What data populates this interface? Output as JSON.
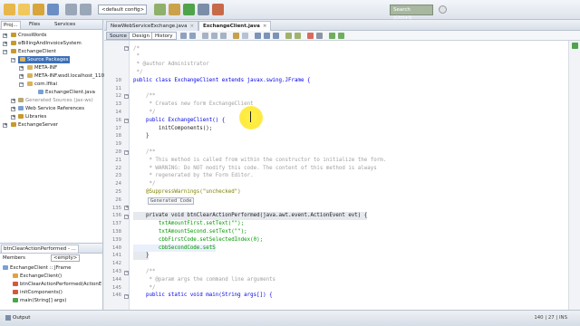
{
  "toolbar": {
    "config": "<default config>",
    "search_label": "Search (Ctrl+I)"
  },
  "projects": {
    "tabs": [
      "Proj...",
      "Files",
      "Services"
    ],
    "tree": [
      {
        "label": "CrossWords",
        "icon_color": "#c79a2e"
      },
      {
        "label": "eBillingAndInvoiceSystem",
        "icon_color": "#c79a2e"
      },
      {
        "label": "ExchangeClient",
        "icon_color": "#c79a2e"
      },
      {
        "label": "Source Packages",
        "icon_color": "#d9b35a"
      },
      {
        "label": "META-INF",
        "icon_color": "#d9b35a"
      },
      {
        "label": "META-INF.wsdl.localhost_110",
        "icon_color": "#d9b35a"
      },
      {
        "label": "com.lfitai",
        "icon_color": "#d9b35a"
      },
      {
        "label": "ExchangeClient.java",
        "icon_color": "#7aa0d4"
      },
      {
        "label": "Generated Sources (jax-ws)",
        "icon_color": "#b9a770"
      },
      {
        "label": "Web Service References",
        "icon_color": "#7aa0d4"
      },
      {
        "label": "Libraries",
        "icon_color": "#c79a2e"
      },
      {
        "label": "ExchangeServer",
        "icon_color": "#c79a2e"
      }
    ]
  },
  "navigator": {
    "title": "btnClearActionPerformed - ...",
    "members_label": "Members",
    "filter": "<empty>",
    "root": "ExchangeClient :: JFrame",
    "items": [
      "ExchangeClient()",
      "btnClearActionPerformed(ActionE",
      "initComponents()",
      "main(String[] args)"
    ]
  },
  "editor": {
    "tabs": [
      "NewWebServiceExchange.java",
      "ExchangeClient.java"
    ],
    "source_label": "Source",
    "design_label": "Design",
    "history_label": "History"
  },
  "code": {
    "lines": [
      {
        "num": "",
        "text": "/*"
      },
      {
        "num": "",
        "text": " *"
      },
      {
        "num": "",
        "text": " * @author Administrator"
      },
      {
        "num": "",
        "text": " */"
      },
      {
        "num": "10",
        "text": "public class ExchangeClient extends javax.swing.JFrame {"
      },
      {
        "num": "11",
        "text": ""
      },
      {
        "num": "12",
        "text": "    /**"
      },
      {
        "num": "13",
        "text": "     * Creates new form ExchangeClient"
      },
      {
        "num": "14",
        "text": "     */"
      },
      {
        "num": "16",
        "text": "    public ExchangeClient() {"
      },
      {
        "num": "17",
        "text": "        initComponents();"
      },
      {
        "num": "18",
        "text": "    }"
      },
      {
        "num": "19",
        "text": ""
      },
      {
        "num": "20",
        "text": "    /**"
      },
      {
        "num": "21",
        "text": "     * This method is called from within the constructor to initialize the form."
      },
      {
        "num": "22",
        "text": "     * WARNING: Do NOT modify this code. The content of this method is always"
      },
      {
        "num": "23",
        "text": "     * regenerated by the Form Editor."
      },
      {
        "num": "24",
        "text": "     */"
      },
      {
        "num": "25",
        "text": "    @SuppressWarnings(\"unchecked\")"
      },
      {
        "num": "26",
        "text": ""
      },
      {
        "num": "135",
        "text": ""
      },
      {
        "num": "136",
        "text": "    private void btnClearActionPerformed(java.awt.event.ActionEvent evt) {"
      },
      {
        "num": "137",
        "text": "        txtAmountFirst.setText(\"\");"
      },
      {
        "num": "138",
        "text": "        txtAmountSecond.setText(\"\");"
      },
      {
        "num": "139",
        "text": "        cbbFirstCode.setSelectedIndex(0);"
      },
      {
        "num": "140",
        "text": "        cbbSecondCode.setS"
      },
      {
        "num": "141",
        "text": "    }"
      },
      {
        "num": "142",
        "text": ""
      },
      {
        "num": "143",
        "text": "    /**"
      },
      {
        "num": "144",
        "text": "     * @param args the command line arguments"
      },
      {
        "num": "145",
        "text": "     */"
      },
      {
        "num": "146",
        "text": "    public static void main(String args[]) {"
      }
    ],
    "generated_code_label": "Generated Code"
  },
  "status": {
    "output_label": "Output",
    "caret": "140 | 27 | INS"
  }
}
